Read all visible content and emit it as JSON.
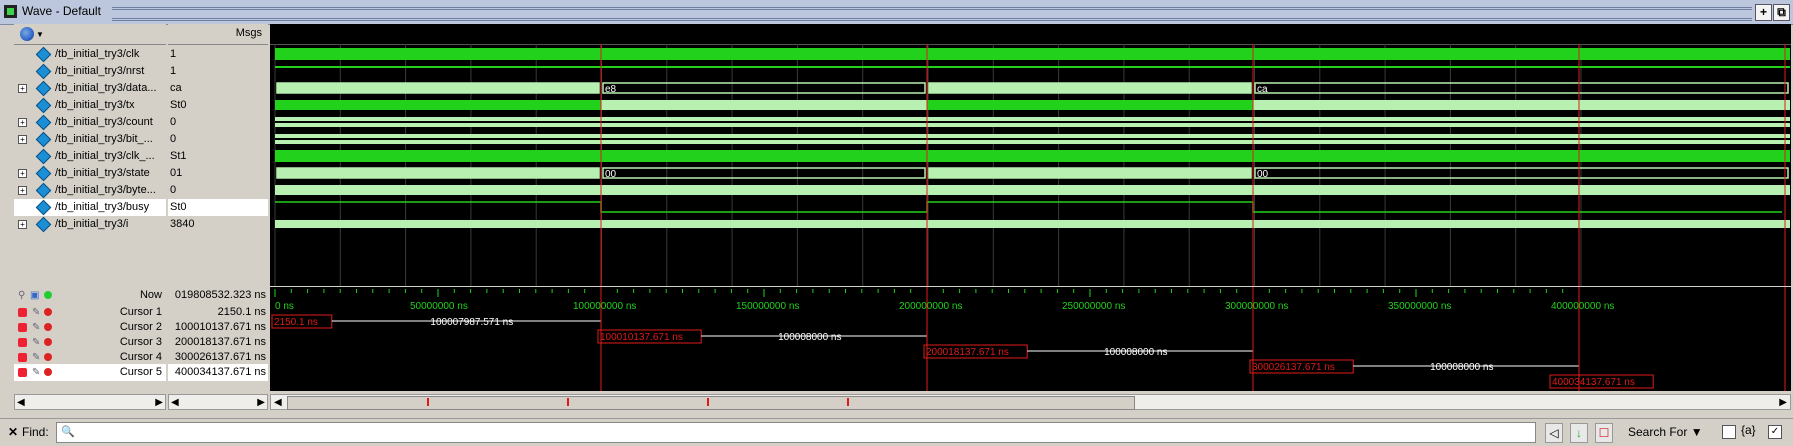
{
  "window": {
    "title": "Wave - Default"
  },
  "header": {
    "msgs_label": "Msgs"
  },
  "signals": [
    {
      "name": "/tb_initial_try3/clk",
      "value": "1",
      "expandable": false
    },
    {
      "name": "/tb_initial_try3/nrst",
      "value": "1",
      "expandable": false
    },
    {
      "name": "/tb_initial_try3/data...",
      "value": "ca",
      "expandable": true
    },
    {
      "name": "/tb_initial_try3/tx",
      "value": "St0",
      "expandable": false
    },
    {
      "name": "/tb_initial_try3/count",
      "value": "0",
      "expandable": true
    },
    {
      "name": "/tb_initial_try3/bit_...",
      "value": "0",
      "expandable": true
    },
    {
      "name": "/tb_initial_try3/clk_...",
      "value": "St1",
      "expandable": false
    },
    {
      "name": "/tb_initial_try3/state",
      "value": "01",
      "expandable": true
    },
    {
      "name": "/tb_initial_try3/byte...",
      "value": "0",
      "expandable": true
    },
    {
      "name": "/tb_initial_try3/busy",
      "value": "St0",
      "expandable": false,
      "selected": true
    },
    {
      "name": "/tb_initial_try3/i",
      "value": "3840",
      "expandable": true
    }
  ],
  "wave_labels": {
    "data_seg1": "e8",
    "data_seg3": "ca",
    "state_seg2": "00",
    "state_seg4": "00"
  },
  "timeline": {
    "now_label": "Now",
    "now_value": "019808532.323 ns",
    "ticks": [
      "0 ns",
      "50000000 ns",
      "100000000 ns",
      "150000000 ns",
      "200000000 ns",
      "250000000 ns",
      "300000000 ns",
      "350000000 ns",
      "400000000 ns"
    ]
  },
  "cursors": [
    {
      "name": "Cursor 1",
      "value": "2150.1 ns",
      "marker": "2150.1 ns",
      "delta": "100007987.571 ns"
    },
    {
      "name": "Cursor 2",
      "value": "100010137.671 ns",
      "marker": "100010137.671 ns",
      "delta": "100008000 ns"
    },
    {
      "name": "Cursor 3",
      "value": "200018137.671 ns",
      "marker": "200018137.671 ns",
      "delta": "100008000 ns"
    },
    {
      "name": "Cursor 4",
      "value": "300026137.671 ns",
      "marker": "300026137.671 ns",
      "delta": "100008000 ns"
    },
    {
      "name": "Cursor 5",
      "value": "400034137.671 ns",
      "marker": "400034137.671 ns",
      "delta": "",
      "selected": true
    }
  ],
  "find": {
    "label": "Find:",
    "value": "",
    "search_for": "Search For",
    "regex_label": "{a}"
  },
  "colors": {
    "wave_green": "#22d11c",
    "wave_light": "#b7f0b0",
    "cursor_red": "#e01a1a",
    "bg": "#000000"
  }
}
